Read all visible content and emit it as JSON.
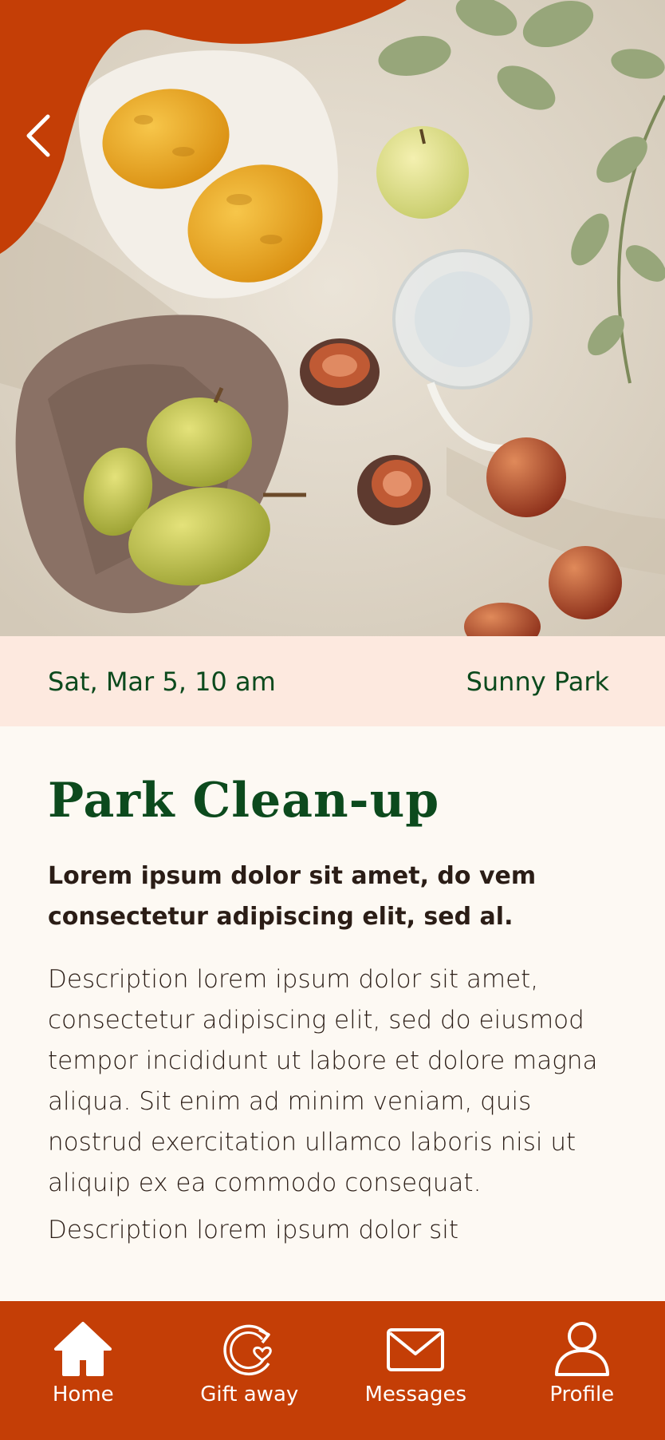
{
  "colors": {
    "accent": "#c43e06",
    "title_green": "#0c4a1d",
    "info_bar_bg": "#fde9df",
    "page_bg": "#fdf9f3"
  },
  "header": {
    "back_icon": "chevron-left-icon",
    "hero_image": "picnic-fruit-photo"
  },
  "event": {
    "date_time": "Sat, Mar 5, 10 am",
    "location": "Sunny Park",
    "title": "Park Clean-up",
    "lead": "Lorem ipsum dolor sit amet, do vem consectetur adipiscing elit, sed al.",
    "description": "Description lorem ipsum dolor sit amet, consectetur adipiscing elit, sed do eiusmod tempor incididunt ut labore et dolore magna aliqua. Sit enim ad minim veniam, quis nostrud exercitation ullamco laboris nisi ut aliquip ex ea commodo consequat.",
    "description_2": "Description lorem ipsum dolor sit"
  },
  "tabbar": {
    "items": [
      {
        "label": "Home",
        "icon": "home-icon"
      },
      {
        "label": "Gift away",
        "icon": "gift-away-icon"
      },
      {
        "label": "Messages",
        "icon": "envelope-icon"
      },
      {
        "label": "Profile",
        "icon": "profile-icon"
      }
    ]
  }
}
